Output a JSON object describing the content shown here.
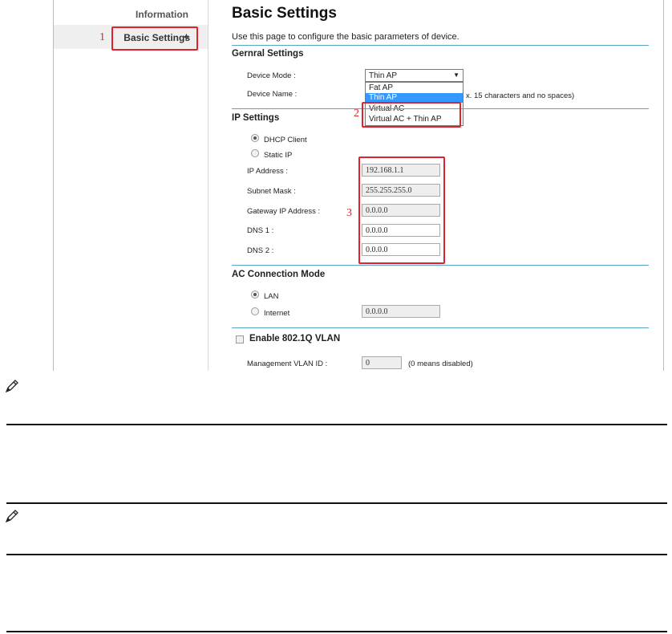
{
  "sidebar": {
    "items": [
      {
        "label": "Information"
      },
      {
        "label": "Basic Settings",
        "active": true
      }
    ]
  },
  "page": {
    "title": "Basic Settings",
    "description": "Use this page to configure the basic parameters of device."
  },
  "general": {
    "heading": "Gernral Settings",
    "device_mode_label": "Device Mode :",
    "device_mode_value": "Thin AP",
    "device_mode_options": [
      "Fat AP",
      "Thin AP",
      "Virtual AC",
      "Virtual AC + Thin AP"
    ],
    "device_name_label": "Device Name :",
    "device_name_hint": "x. 15 characters and no spaces)"
  },
  "ip": {
    "heading": "IP Settings",
    "dhcp_label": "DHCP Client",
    "static_label": "Static IP",
    "ip_address_label": "IP Address :",
    "ip_address_value": "192.168.1.1",
    "subnet_label": "Subnet Mask :",
    "subnet_value": "255.255.255.0",
    "gateway_label": "Gateway IP Address :",
    "gateway_value": "0.0.0.0",
    "dns1_label": "DNS 1 :",
    "dns1_value": "0.0.0.0",
    "dns2_label": "DNS 2 :",
    "dns2_value": "0.0.0.0"
  },
  "ac": {
    "heading": "AC Connection Mode",
    "lan_label": "LAN",
    "internet_label": "Internet",
    "internet_value": "0.0.0.0"
  },
  "vlan": {
    "heading": "Enable 802.1Q VLAN",
    "mgmt_label": "Management VLAN ID :",
    "mgmt_value": "0",
    "mgmt_hint": "(0 means disabled)"
  },
  "callouts": {
    "one": "1",
    "two": "2",
    "three": "3"
  },
  "colors": {
    "accent_rule": "#5aa7c5",
    "callout_red": "#e0232a",
    "selected_option": "#3399ff"
  }
}
